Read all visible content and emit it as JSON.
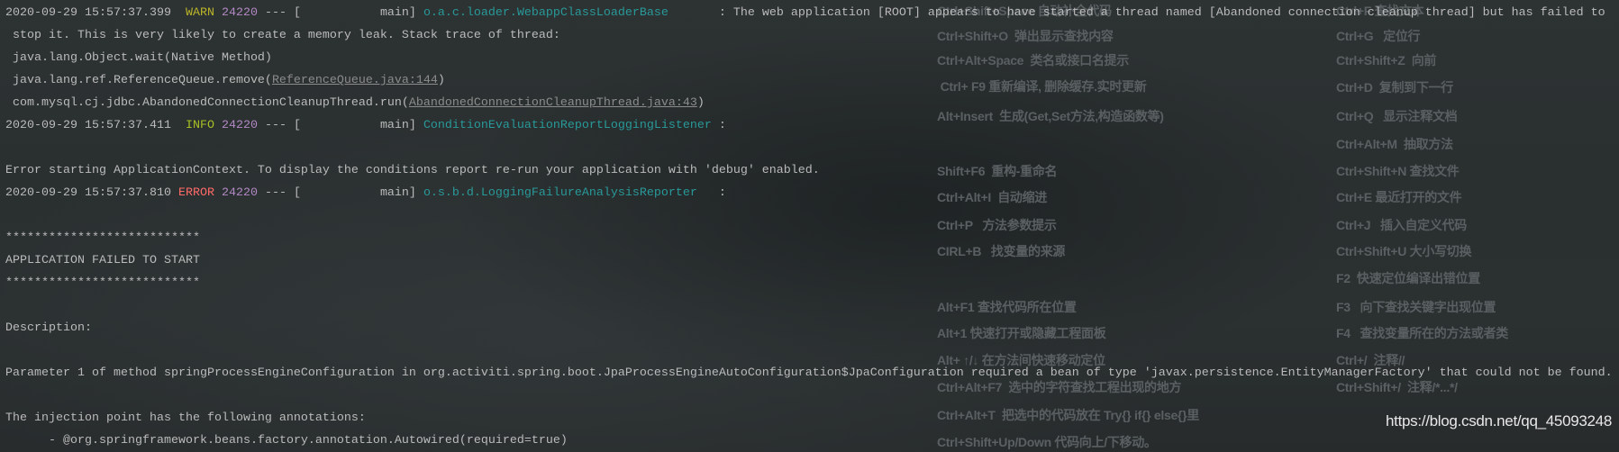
{
  "background_hotkeys": {
    "left": [
      "Ctrl+Shift+Space 自动补全代码",
      "Ctrl+Shift+O  弹出显示查找内容",
      "Ctrl+Alt+Space  类名或接口名提示",
      " Ctrl+ F9 重新编译, 删除缓存.实时更新",
      "Alt+Insert  生成(Get,Set方法,构造函数等)",
      "Shift+F6  重构-重命名",
      "Ctrl+Alt+I  自动缩进",
      "Ctrl+P   方法参数提示",
      "CIRL+B   找变量的来源",
      "Alt+F1 查找代码所在位置",
      "Alt+1 快速打开或隐藏工程面板",
      "Alt+ ↑/↓ 在方法间快速移动定位",
      "Ctrl+Alt+F7  选中的字符查找工程出现的地方",
      "Ctrl+Alt+T  把选中的代码放在 Try{} if{} else{}里",
      "Ctrl+Shift+Up/Down 代码向上/下移动。"
    ],
    "right": [
      "Ctrl+F 查找文本",
      "Ctrl+G   定位行",
      "Ctrl+Shift+Z  向前",
      "Ctrl+D  复制到下一行",
      "Ctrl+Q   显示注释文档",
      "Ctrl+Alt+M  抽取方法",
      "Ctrl+Shift+N 查找文件",
      "Ctrl+E 最近打开的文件",
      "Ctrl+J   插入自定义代码",
      "Ctrl+Shift+U 大小写切换",
      "F2  快速定位编译出错位置",
      "F3   向下查找关键字出现位置",
      "F4   查找变量所在的方法或者类",
      "Ctrl+/  注释//",
      "Ctrl+Shift+/  注释/*...*/"
    ]
  },
  "watermark": "https://blog.csdn.net/qq_45093248",
  "colors": {
    "warn": "#bbb529",
    "info": "#a8c023",
    "error": "#ff6b68",
    "pid": "#b389c5",
    "logger": "#299999",
    "text": "#bbbbbb"
  },
  "console": {
    "lines": [
      [
        {
          "t": "2020-09-29 15:57:37.399  "
        },
        {
          "t": "WARN",
          "c": "warn"
        },
        {
          "t": " "
        },
        {
          "t": "24220",
          "c": "pid"
        },
        {
          "t": " --- [           main] "
        },
        {
          "t": "o.a.c.loader.WebappClassLoaderBase",
          "c": "logger"
        },
        {
          "t": "       : The web application [ROOT] appears to have started a thread named [Abandoned connection cleanup thread] but has failed to"
        }
      ],
      [
        {
          "t": " stop it. This is very likely to create a memory leak. Stack trace of thread:"
        }
      ],
      [
        {
          "t": " java.lang.Object.wait(Native Method)"
        }
      ],
      [
        {
          "t": " java.lang.ref.ReferenceQueue.remove("
        },
        {
          "t": "ReferenceQueue.java:144",
          "c": "link"
        },
        {
          "t": ")"
        }
      ],
      [
        {
          "t": " com.mysql.cj.jdbc.AbandonedConnectionCleanupThread.run("
        },
        {
          "t": "AbandonedConnectionCleanupThread.java:43",
          "c": "link"
        },
        {
          "t": ")"
        }
      ],
      [
        {
          "t": "2020-09-29 15:57:37.411  "
        },
        {
          "t": "INFO",
          "c": "info"
        },
        {
          "t": " "
        },
        {
          "t": "24220",
          "c": "pid"
        },
        {
          "t": " --- [           main] "
        },
        {
          "t": "ConditionEvaluationReportLoggingListener",
          "c": "logger"
        },
        {
          "t": " :"
        }
      ],
      [],
      [
        {
          "t": "Error starting ApplicationContext. To display the conditions report re-run your application with 'debug' enabled."
        }
      ],
      [
        {
          "t": "2020-09-29 15:57:37.810 "
        },
        {
          "t": "ERROR",
          "c": "error"
        },
        {
          "t": " "
        },
        {
          "t": "24220",
          "c": "pid"
        },
        {
          "t": " --- [           main] "
        },
        {
          "t": "o.s.b.d.LoggingFailureAnalysisReporter",
          "c": "logger"
        },
        {
          "t": "   :"
        }
      ],
      [],
      [
        {
          "t": "***************************"
        }
      ],
      [
        {
          "t": "APPLICATION FAILED TO START"
        }
      ],
      [
        {
          "t": "***************************"
        }
      ],
      [],
      [
        {
          "t": "Description:"
        }
      ],
      [],
      [
        {
          "t": "Parameter 1 of method springProcessEngineConfiguration in org.activiti.spring.boot.JpaProcessEngineAutoConfiguration$JpaConfiguration required a bean of type 'javax.persistence.EntityManagerFactory' that could not be found."
        }
      ],
      [],
      [
        {
          "t": "The injection point has the following annotations:"
        }
      ],
      [
        {
          "t": "\t- @org.springframework.beans.factory.annotation.Autowired(required=true)"
        }
      ]
    ]
  }
}
